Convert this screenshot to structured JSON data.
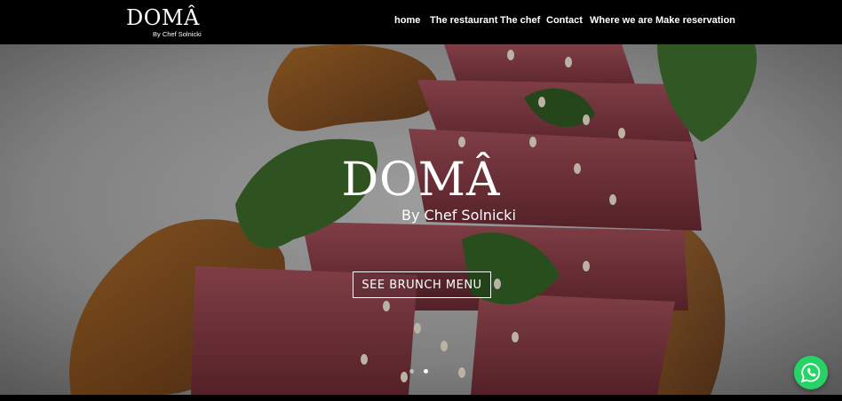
{
  "header": {
    "logo_main": "DOMÂ",
    "logo_sub": "By Chef Solnicki"
  },
  "nav": {
    "items": [
      {
        "label": "home"
      },
      {
        "label": "The restaurant"
      },
      {
        "label": "The chef"
      },
      {
        "label": "Contact"
      },
      {
        "label": "Where we are"
      },
      {
        "label": "Make reservation"
      }
    ]
  },
  "hero": {
    "title": "DOMÂ",
    "subtitle": "By Chef Solnicki",
    "cta_label": "SEE BRUNCH MENU",
    "slides_total": 2,
    "active_slide": 2
  },
  "widgets": {
    "whatsapp_icon": "whatsapp-icon",
    "whatsapp_color": "#25d366"
  }
}
